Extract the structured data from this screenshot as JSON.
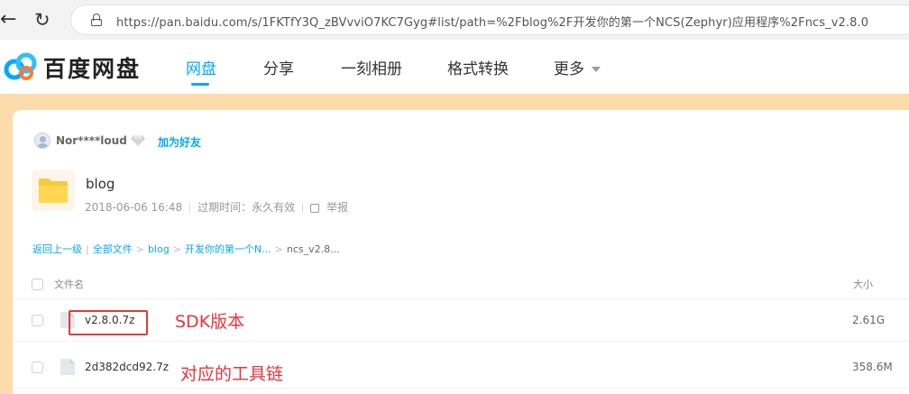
{
  "browser": {
    "url": "https://pan.baidu.com/s/1FKTfY3Q_zBVvviO7KC7Gyg#list/path=%2Fblog%2F开发你的第一个NCS(Zephyr)应用程序%2Fncs_v2.8.0",
    "back_icon": "arrow-left-icon",
    "reload_icon": "reload-icon",
    "lock_icon": "lock-icon"
  },
  "header": {
    "logo_text": "百度网盘",
    "nav": [
      {
        "label": "网盘",
        "active": true
      },
      {
        "label": "分享",
        "active": false
      },
      {
        "label": "一刻相册",
        "active": false
      },
      {
        "label": "格式转换",
        "active": false
      },
      {
        "label": "更多",
        "active": false
      }
    ],
    "accent": "#06a7ff"
  },
  "share": {
    "username": "Nor****loud",
    "add_friend": "加为好友",
    "title": "blog",
    "date": "2018-06-06 16:48",
    "expiry": "过期时间：永久有效",
    "report": "举报"
  },
  "breadcrumb": {
    "back": "返回上一级",
    "all": "全部文件",
    "items": [
      "blog",
      "开发你的第一个N..."
    ],
    "current": "ncs_v2.8..."
  },
  "list": {
    "col_name": "文件名",
    "col_size": "大小",
    "rows": [
      {
        "name": "v2.8.0.7z",
        "size": "2.61G"
      },
      {
        "name": "2d382dcd92.7z",
        "size": "358.6M"
      }
    ]
  },
  "annotations": {
    "sdk": "SDK版本",
    "toolchain": "对应的工具链",
    "color": "#e8353a"
  }
}
